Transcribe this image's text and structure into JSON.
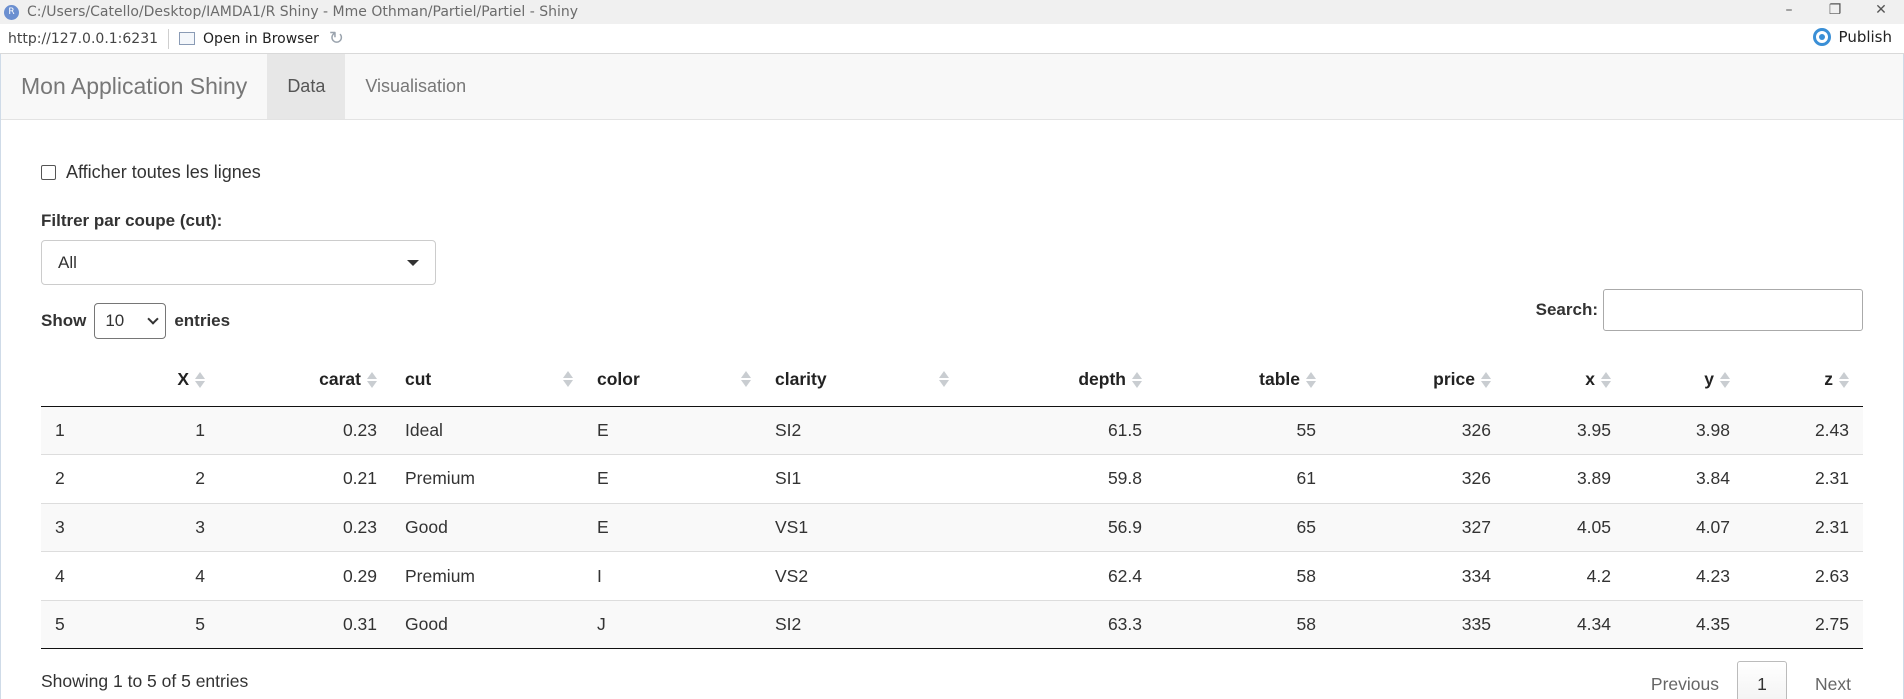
{
  "window": {
    "title": "C:/Users/Catello/Desktop/IAMDA1/R Shiny - Mme Othman/Partiel/Partiel - Shiny",
    "app_icon": "R",
    "minimize": "–",
    "restore": "❐",
    "close": "✕"
  },
  "toolbar": {
    "url": "http://127.0.0.1:6231",
    "open_browser": "Open in Browser",
    "refresh_icon": "↻",
    "publish": "Publish",
    "publish_color": "#3a8fd6"
  },
  "navbar": {
    "brand": "Mon Application Shiny",
    "tabs": [
      {
        "label": "Data",
        "active": true
      },
      {
        "label": "Visualisation",
        "active": false
      }
    ]
  },
  "controls": {
    "show_all_label": "Afficher toutes les lignes",
    "show_all_checked": false,
    "filter_label": "Filtrer par coupe (cut):",
    "filter_value": "All"
  },
  "datatable": {
    "show_label": "Show",
    "entries_value": "10",
    "entries_label": "entries",
    "search_label": "Search:",
    "search_value": "",
    "columns": [
      "",
      "X",
      "carat",
      "cut",
      "color",
      "clarity",
      "depth",
      "table",
      "price",
      "x",
      "y",
      "z"
    ],
    "rows": [
      [
        "1",
        "1",
        "0.23",
        "Ideal",
        "E",
        "SI2",
        "61.5",
        "55",
        "326",
        "3.95",
        "3.98",
        "2.43"
      ],
      [
        "2",
        "2",
        "0.21",
        "Premium",
        "E",
        "SI1",
        "59.8",
        "61",
        "326",
        "3.89",
        "3.84",
        "2.31"
      ],
      [
        "3",
        "3",
        "0.23",
        "Good",
        "E",
        "VS1",
        "56.9",
        "65",
        "327",
        "4.05",
        "4.07",
        "2.31"
      ],
      [
        "4",
        "4",
        "0.29",
        "Premium",
        "I",
        "VS2",
        "62.4",
        "58",
        "334",
        "4.2",
        "4.23",
        "2.63"
      ],
      [
        "5",
        "5",
        "0.31",
        "Good",
        "J",
        "SI2",
        "63.3",
        "58",
        "335",
        "4.34",
        "4.35",
        "2.75"
      ]
    ],
    "info": "Showing 1 to 5 of 5 entries",
    "previous": "Previous",
    "page": "1",
    "next": "Next"
  }
}
